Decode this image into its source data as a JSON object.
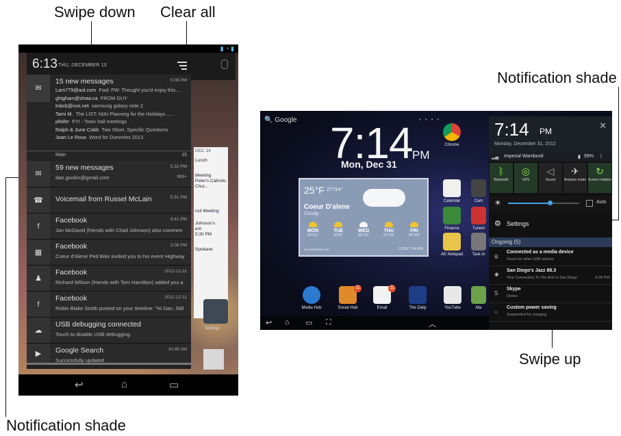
{
  "callouts": {
    "swipe_down": "Swipe down",
    "clear_all": "Clear all",
    "notification_shade_left": "Notification shade",
    "notification_shade_right": "Notification shade",
    "swipe_up": "Swipe up"
  },
  "phone": {
    "time": "6:13",
    "date": "THU, DECEMBER 13",
    "gmail_group": {
      "title": "15 new messages",
      "time": "5:08 PM",
      "lines": [
        {
          "sender": "Lam779@aol.com",
          "text": "Fwd: FW: Thought you'd enjoy this..."
        },
        {
          "sender": "ghigham@shaw.ca",
          "text": "FROM GUY"
        },
        {
          "sender": "tnbcb@cox.net",
          "text": "samsung galaxy note 2"
        },
        {
          "sender": "Tami M.",
          "text": "The LIST: NIAI Planning for the Holidays ....."
        },
        {
          "sender": "pfeifer",
          "text": "FYI - Town hall meetings"
        },
        {
          "sender": "Ralph & June Cobb",
          "text": "Two Short, Specific Questions"
        },
        {
          "sender": "Joan Le Roux",
          "text": "Word for Dummies 2013"
        }
      ],
      "footer_label": "Main",
      "footer_count": "15"
    },
    "notifications": [
      {
        "title": "59 new messages",
        "sub": "dan.gookin@gmail.com",
        "time": "5:32 PM",
        "count": "999+",
        "icon": "gmail-icon"
      },
      {
        "title": "Voicemail from Russel McLain",
        "sub": "",
        "time": "5:31 PM",
        "icon": "voicemail-icon"
      },
      {
        "title": "Facebook",
        "sub": "Jon McDavid (friends with Chad Johnson) also commen",
        "time": "3:41 PM",
        "icon": "facebook-icon"
      },
      {
        "title": "Facebook",
        "sub": "Coeur d'Alene Ped Bike invited you to his event Highway",
        "time": "2:08 PM",
        "icon": "calendar-icon"
      },
      {
        "title": "Facebook",
        "sub": "Richard Wilson (friends with Tom Hamilton) added you a",
        "time": "2012-12-11",
        "icon": "friend-icon"
      },
      {
        "title": "Facebook",
        "sub": "Robin Blake Smith posted on your timeline: \"Hi Dan, Still",
        "time": "2012-12-11",
        "icon": "facebook-icon"
      },
      {
        "title": "USB debugging connected",
        "sub": "Touch to disable USB debugging.",
        "time": "",
        "icon": "android-debug-icon"
      },
      {
        "title": "Google Search",
        "sub": "Successfully updated",
        "time": "10:49 AM",
        "icon": "play-store-icon"
      }
    ],
    "behind": {
      "date_head": "DEC 14",
      "items": [
        "Lunch",
        "Meeting",
        "Peter's Catholic Chur...",
        "ncil Meeting",
        "Johnson's",
        "ent",
        "5:30 PM",
        "Spokane"
      ],
      "settings_label": "Settings"
    }
  },
  "tablet": {
    "search_label": "Google",
    "clock": "7:14",
    "clock_pm": "PM",
    "date": "Mon, Dec 31",
    "weather": {
      "temp": "25°F",
      "hilo": "27°/14°",
      "city": "Coeur D'alene",
      "condition": "Cloudy",
      "days": [
        {
          "name": "MON",
          "temps": "24°/11°"
        },
        {
          "name": "TUE",
          "temps": "32°/6°"
        },
        {
          "name": "WED",
          "temps": "36°/10°"
        },
        {
          "name": "THU",
          "temps": "37°/16°"
        },
        {
          "name": "FRI",
          "temps": "34°/28°"
        }
      ],
      "source": "AccuWeather.com",
      "updated": "12/30 7:24 PM"
    },
    "apps_right": [
      "Chrome",
      "Calendar",
      "Finance",
      "AK Notepad"
    ],
    "apps_right_cut": [
      "Cam",
      "Tunein",
      "Task m"
    ],
    "dock": [
      {
        "label": "Media Hub",
        "color": "#2a7ad1"
      },
      {
        "label": "Social Hub",
        "color": "#e08a2a",
        "badge": "11"
      },
      {
        "label": "Email",
        "color": "#f2f2f2",
        "badge": "11"
      },
      {
        "label": "The Daily",
        "color": "#1c3e86"
      },
      {
        "label": "YouTube",
        "color": "#e8e8e8"
      },
      {
        "label": "Ma",
        "color": "#6ba24a"
      }
    ],
    "panel": {
      "time": "7:14",
      "pm": "PM",
      "date": "Monday, December 31, 2012",
      "carrier": "Imperial Wambooli",
      "battery": "99%",
      "toggles": [
        "Bluetooth",
        "GPS",
        "Sound",
        "Airplane mode",
        "Screen rotation"
      ],
      "auto_label": "Auto",
      "settings_label": "Settings",
      "ongoing_label": "Ongoing (5)",
      "ongoing": [
        {
          "title": "Connected as a media device",
          "sub": "Touch for other USB options",
          "time": ""
        },
        {
          "title": "San Diego's Jazz 88.3",
          "sub": "Your Connection To The Arts In San Diego",
          "time": "6:28 PM"
        },
        {
          "title": "Skype",
          "sub": "Online",
          "time": ""
        },
        {
          "title": "Custom power saving",
          "sub": "Suspended for charging",
          "time": ""
        }
      ]
    }
  }
}
